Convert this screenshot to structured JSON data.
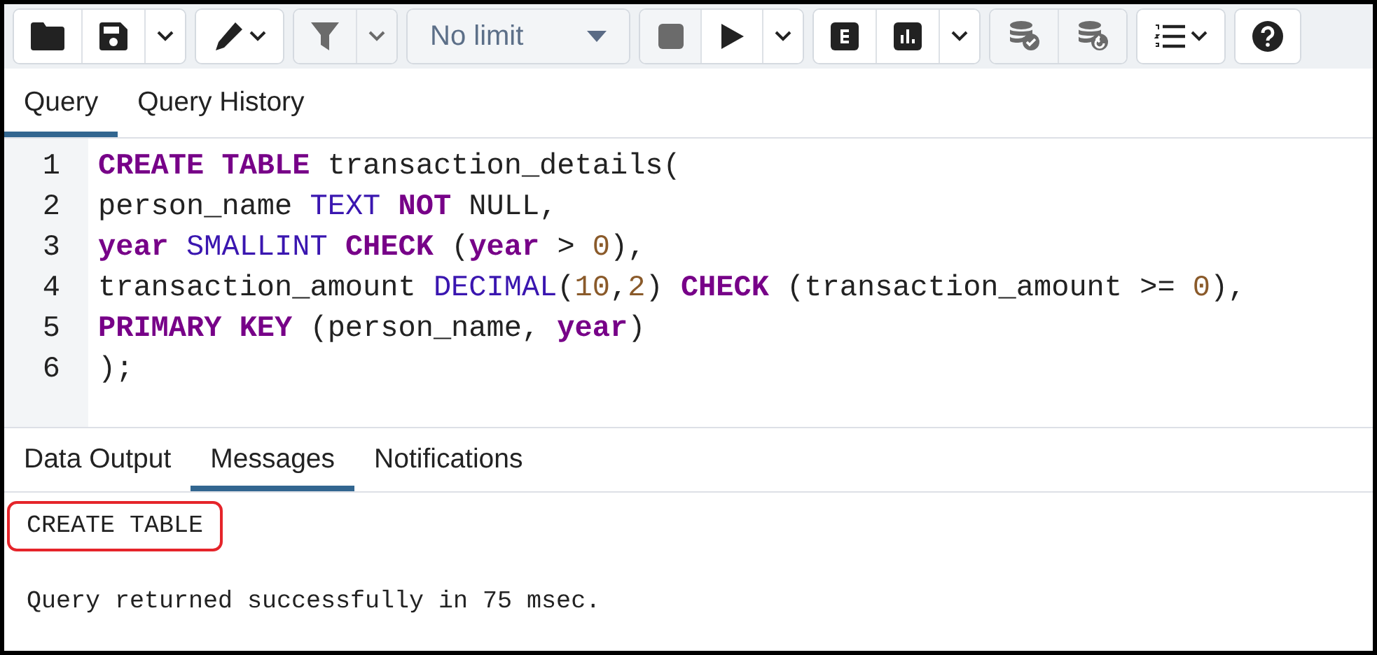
{
  "toolbar": {
    "groups": [
      {
        "buttons": [
          {
            "kind": "open",
            "disabled": false
          },
          {
            "kind": "save",
            "disabled": false
          },
          {
            "kind": "caret",
            "disabled": false
          }
        ]
      },
      {
        "buttons": [
          {
            "kind": "edit",
            "disabled": false
          }
        ]
      },
      {
        "buttons": [
          {
            "kind": "filter",
            "disabled": true
          },
          {
            "kind": "caret",
            "disabled": true
          }
        ]
      },
      {
        "buttons": [
          {
            "kind": "limit-select",
            "disabled": true,
            "label": "No limit"
          }
        ]
      },
      {
        "buttons": [
          {
            "kind": "stop",
            "disabled": true
          },
          {
            "kind": "execute",
            "disabled": false
          },
          {
            "kind": "caret",
            "disabled": false
          }
        ]
      },
      {
        "buttons": [
          {
            "kind": "explain",
            "disabled": false
          },
          {
            "kind": "explain-analyze",
            "disabled": false
          },
          {
            "kind": "caret",
            "disabled": false
          }
        ]
      },
      {
        "buttons": [
          {
            "kind": "commit",
            "disabled": true
          },
          {
            "kind": "rollback",
            "disabled": true
          }
        ]
      },
      {
        "buttons": [
          {
            "kind": "macros",
            "disabled": false
          }
        ]
      },
      {
        "buttons": [
          {
            "kind": "help",
            "disabled": false
          }
        ]
      }
    ]
  },
  "editor_tabs": [
    {
      "label": "Query",
      "selected": true
    },
    {
      "label": "Query History",
      "selected": false
    }
  ],
  "editor": {
    "lines": [
      {
        "number": "1",
        "tokens": [
          {
            "kind": "keyword",
            "text": "CREATE TABLE"
          },
          {
            "kind": "plain",
            "text": " transaction_details("
          }
        ]
      },
      {
        "number": "2",
        "tokens": [
          {
            "kind": "plain",
            "text": "person_name "
          },
          {
            "kind": "type",
            "text": "TEXT"
          },
          {
            "kind": "keyword",
            "text": " NOT"
          },
          {
            "kind": "plain",
            "text": " NULL,"
          }
        ]
      },
      {
        "number": "3",
        "tokens": [
          {
            "kind": "keyword",
            "text": "year"
          },
          {
            "kind": "type",
            "text": " SMALLINT"
          },
          {
            "kind": "keyword",
            "text": " CHECK"
          },
          {
            "kind": "plain",
            "text": " ("
          },
          {
            "kind": "keyword",
            "text": "year"
          },
          {
            "kind": "plain",
            "text": " > "
          },
          {
            "kind": "number",
            "text": "0"
          },
          {
            "kind": "plain",
            "text": "),"
          }
        ]
      },
      {
        "number": "4",
        "tokens": [
          {
            "kind": "plain",
            "text": "transaction_amount "
          },
          {
            "kind": "type",
            "text": "DECIMAL"
          },
          {
            "kind": "plain",
            "text": "("
          },
          {
            "kind": "number",
            "text": "10"
          },
          {
            "kind": "plain",
            "text": ","
          },
          {
            "kind": "number",
            "text": "2"
          },
          {
            "kind": "plain",
            "text": ") "
          },
          {
            "kind": "keyword",
            "text": "CHECK"
          },
          {
            "kind": "plain",
            "text": " (transaction_amount >= "
          },
          {
            "kind": "number",
            "text": "0"
          },
          {
            "kind": "plain",
            "text": "),"
          }
        ]
      },
      {
        "number": "5",
        "tokens": [
          {
            "kind": "keyword",
            "text": "PRIMARY KEY"
          },
          {
            "kind": "plain",
            "text": " (person_name, "
          },
          {
            "kind": "keyword",
            "text": "year"
          },
          {
            "kind": "plain",
            "text": ")"
          }
        ]
      },
      {
        "number": "6",
        "tokens": [
          {
            "kind": "plain",
            "text": ");"
          }
        ]
      }
    ]
  },
  "result_tabs": [
    {
      "label": "Data Output",
      "selected": false
    },
    {
      "label": "Messages",
      "selected": true
    },
    {
      "label": "Notifications",
      "selected": false
    }
  ],
  "messages": [
    {
      "text": "CREATE TABLE",
      "highlighted": true
    },
    {
      "text": "Query returned successfully in 75 msec.",
      "highlighted": false
    }
  ]
}
